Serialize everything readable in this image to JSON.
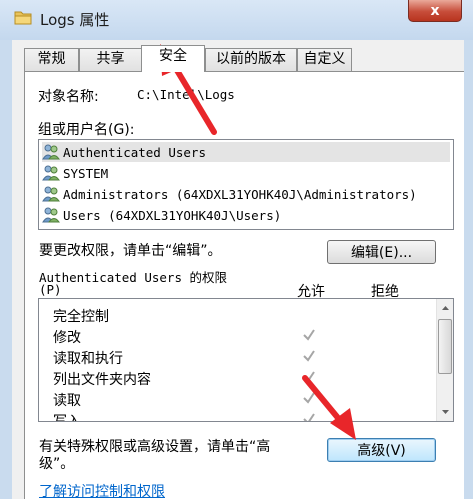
{
  "window": {
    "title": "Logs 属性",
    "close_label": "x",
    "folder_icon": "folder-icon",
    "close_icon": "close-icon"
  },
  "tabs": [
    {
      "label": "常规",
      "active": false
    },
    {
      "label": "共享",
      "active": false
    },
    {
      "label": "安全",
      "active": true
    },
    {
      "label": "以前的版本",
      "active": false
    },
    {
      "label": "自定义",
      "active": false
    }
  ],
  "security": {
    "object_name_label": "对象名称:",
    "object_name_value": "C:\\Intel\\Logs",
    "group_label": "组或用户名(G):",
    "users": [
      {
        "name": "Authenticated Users",
        "selected": true
      },
      {
        "name": "SYSTEM",
        "selected": false
      },
      {
        "name": "Administrators (64XDXL31YOHK40J\\Administrators)",
        "selected": false
      },
      {
        "name": "Users (64XDXL31YOHK40J\\Users)",
        "selected": false
      }
    ],
    "change_perm_text": "要更改权限，请单击“编辑”。",
    "edit_button": "编辑(E)...",
    "perm_heading_line1": "Authenticated Users 的权限",
    "perm_heading_line2": "(P)",
    "allow_header": "允许",
    "deny_header": "拒绝",
    "permissions": [
      {
        "name": "完全控制",
        "allow": false
      },
      {
        "name": "修改",
        "allow": true
      },
      {
        "name": "读取和执行",
        "allow": true
      },
      {
        "name": "列出文件夹内容",
        "allow": true
      },
      {
        "name": "读取",
        "allow": true
      },
      {
        "name": "写入",
        "allow": true
      }
    ],
    "advanced_text_line1": "有关特殊权限或高级设置，请单击“高",
    "advanced_text_line2": "级”。",
    "advanced_button": "高级(V)",
    "help_link": "了解访问控制和权限"
  },
  "colors": {
    "arrow": "#e8262a",
    "link": "#0066cc",
    "check": "#a6a6a6"
  }
}
